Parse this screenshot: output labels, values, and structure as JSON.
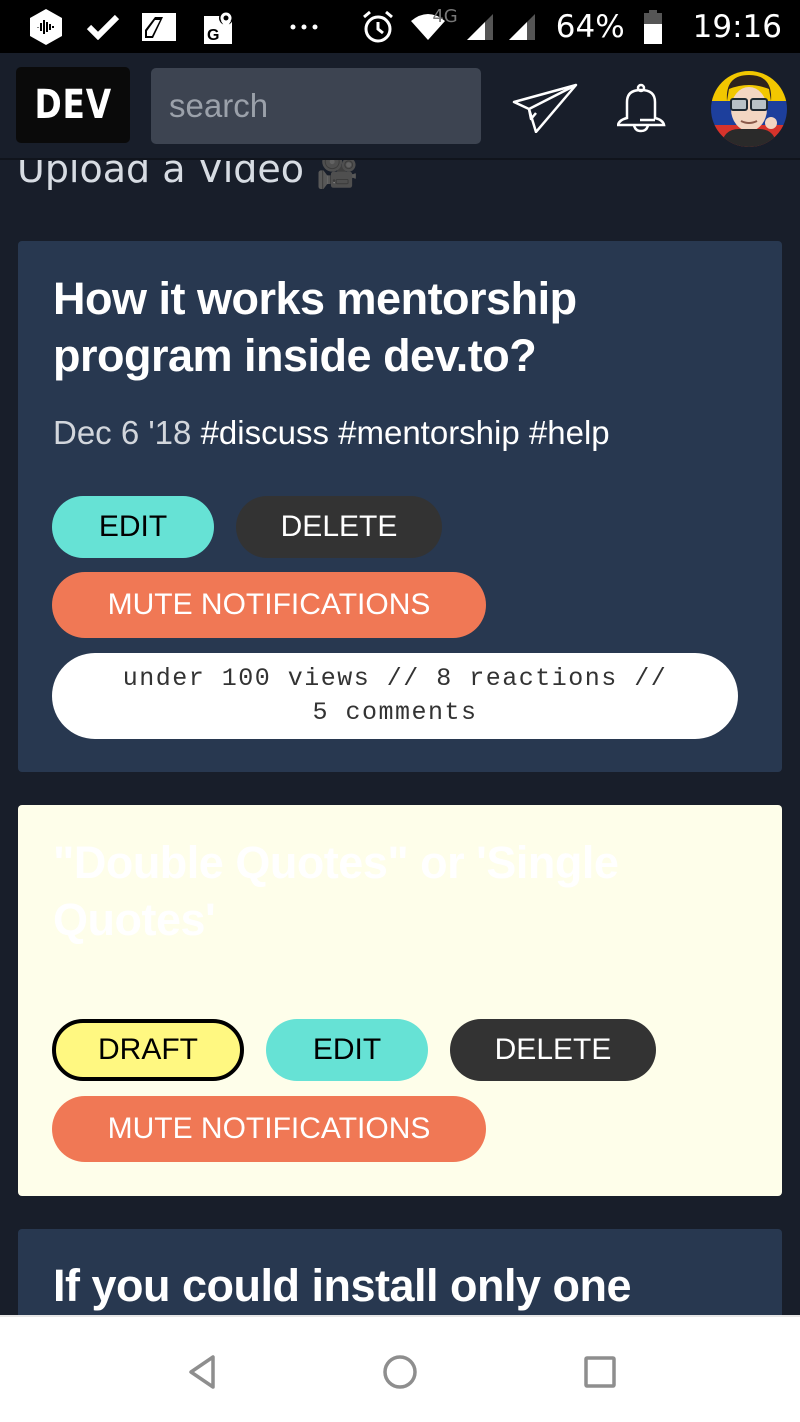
{
  "status_bar": {
    "left_icons": [
      "castbox-icon",
      "check-icon",
      "screenshot-icon",
      "google-maps-icon",
      "more-notifications-icon"
    ],
    "network_type": "4G",
    "battery": "64%",
    "time": "19:16"
  },
  "top_nav": {
    "logo": "DEV",
    "search_placeholder": "search",
    "icons": [
      "send-icon",
      "bell-icon",
      "avatar"
    ]
  },
  "header_text": {
    "upload_label": "Upload a Video",
    "upload_emoji": "🎥"
  },
  "articles": [
    {
      "title_line1": "How it works mentorship",
      "title_line2": "program inside dev.to?",
      "date": "Dec 6 '18",
      "tags": "#discuss #mentorship #help",
      "edit_label": "EDIT",
      "delete_label": "DELETE",
      "mute_label": "MUTE NOTIFICATIONS",
      "stats_line1": "under 100 views // 8 reactions //",
      "stats_line2": "5 comments",
      "state": "published"
    },
    {
      "title_line1": "\"Double Quotes\" or 'Single",
      "title_line2": "Quotes'",
      "draft_label": "DRAFT",
      "edit_label": "EDIT",
      "delete_label": "DELETE",
      "mute_label": "MUTE NOTIFICATIONS",
      "state": "draft"
    },
    {
      "title_line1": "If you could install only one"
    }
  ],
  "colors": {
    "background": "#181e2a",
    "card_dark": "#283850",
    "card_draft": "#fefeea",
    "edit": "#66e2d5",
    "delete": "#333333",
    "mute": "#f07855",
    "draft": "#fff881"
  },
  "android_nav": [
    "back-icon",
    "home-icon",
    "recents-icon"
  ]
}
